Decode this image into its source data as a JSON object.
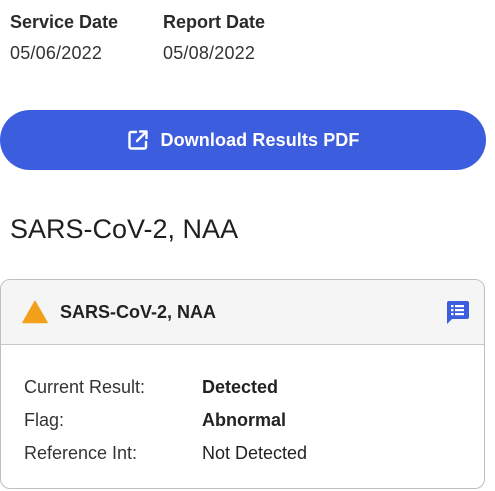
{
  "dates": {
    "service_label": "Service Date",
    "service_value": "05/06/2022",
    "report_label": "Report Date",
    "report_value": "05/08/2022"
  },
  "download": {
    "label": "Download Results PDF",
    "icon": "external-link-icon",
    "color": "#3d5ddf"
  },
  "test_title": "SARS-CoV-2, NAA",
  "card": {
    "title": "SARS-CoV-2, NAA",
    "status_icon": "warning-triangle-icon",
    "status_color": "#f2a01a",
    "comment_icon": "comment-list-icon",
    "rows": [
      {
        "label": "Current Result:",
        "value": "Detected"
      },
      {
        "label": "Flag:",
        "value": "Abnormal"
      },
      {
        "label": "Reference Int:",
        "value": "Not Detected"
      }
    ]
  }
}
